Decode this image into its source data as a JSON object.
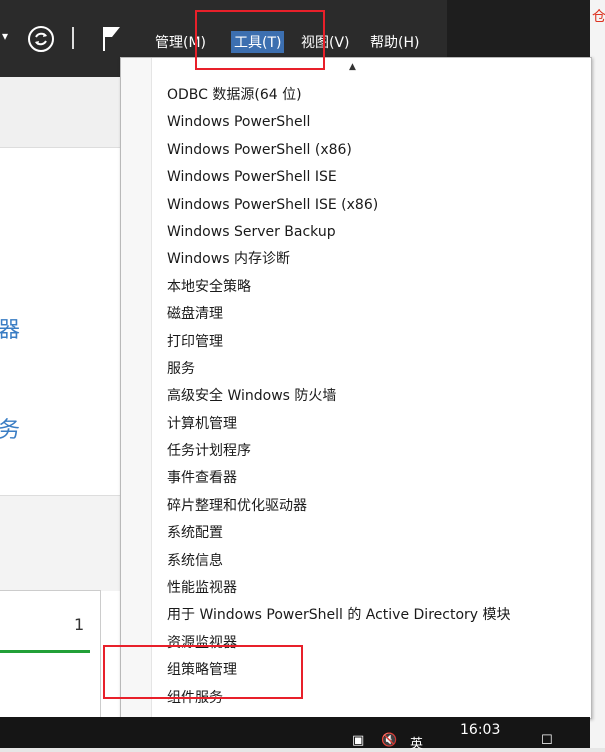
{
  "toolbar": {
    "menus": [
      {
        "label": "管理(M)"
      },
      {
        "label": "工具(T)"
      },
      {
        "label": "视图(V)"
      },
      {
        "label": "帮助(H)"
      }
    ],
    "active_menu": "工具(T)",
    "dropdown_glyph": "▾",
    "separator": "|"
  },
  "left_panel": {
    "chars": [
      "器",
      "务"
    ],
    "count": "1"
  },
  "edge": {
    "text": "仓"
  },
  "tools_menu": {
    "items": [
      "ODBC 数据源(64 位)",
      "Windows PowerShell",
      "Windows PowerShell (x86)",
      "Windows PowerShell ISE",
      "Windows PowerShell ISE (x86)",
      "Windows Server Backup",
      "Windows 内存诊断",
      "本地安全策略",
      "磁盘清理",
      "打印管理",
      "服务",
      "高级安全 Windows 防火墙",
      "计算机管理",
      "任务计划程序",
      "事件查看器",
      "碎片整理和优化驱动器",
      "系统配置",
      "系统信息",
      "性能监视器",
      "用于 Windows PowerShell 的 Active Directory 模块",
      "资源监视器",
      "组策略管理",
      "组件服务"
    ],
    "highlighted_item": "组策略管理"
  },
  "taskbar": {
    "clock": "16:03",
    "ime": "英"
  },
  "colors": {
    "toolbar_bg": "#2b2b2b",
    "highlight_red": "#e8202a",
    "link_blue": "#3a7dc4",
    "status_green": "#22a038"
  }
}
